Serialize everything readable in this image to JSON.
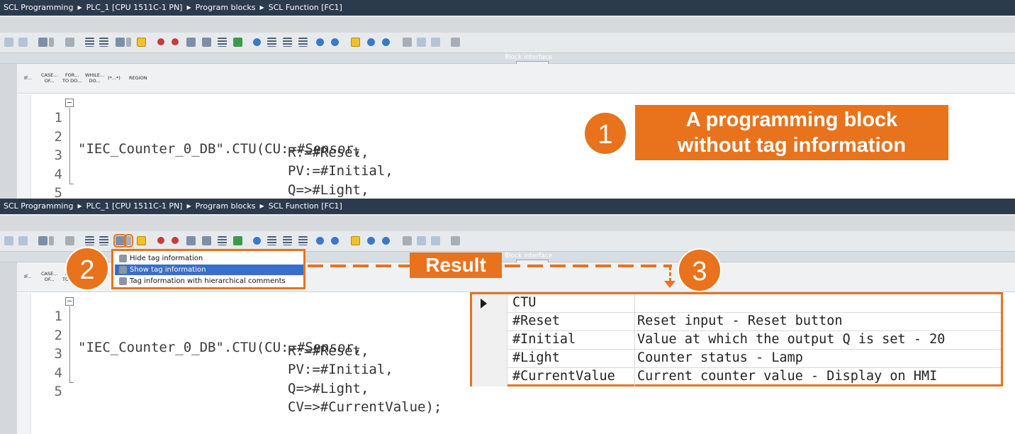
{
  "breadcrumb": [
    "SCL Programming",
    "PLC_1 [CPU 1511C-1 PN]",
    "Program blocks",
    "SCL Function [FC1]"
  ],
  "block_interface_label": "Block interface",
  "keywords": [
    {
      "l1": "IF...",
      "l2": ""
    },
    {
      "l1": "CASE...",
      "l2": "OF..."
    },
    {
      "l1": "FOR...",
      "l2": "TO DO..."
    },
    {
      "l1": "WHILE...",
      "l2": "DO..."
    },
    {
      "l1": "(*...*)",
      "l2": ""
    },
    {
      "l1": "REGION",
      "l2": ""
    }
  ],
  "code": {
    "line_numbers": [
      "1",
      "2",
      "3",
      "4",
      "5"
    ],
    "l1_str": "\"IEC_Counter_0_DB\"",
    "l1_dot": ".",
    "l1_fn": "CTU",
    "l1_rest": "(CU:=#Sensor,",
    "l2": "R:=#Reset,",
    "l3": "PV:=#Initial,",
    "l4": "Q=>#Light,",
    "l5": "CV=>#CurrentValue);"
  },
  "annotations": {
    "badge1": "1",
    "badge2": "2",
    "badge3": "3",
    "callout1_line1": "A programming block",
    "callout1_line2": "without tag information",
    "result_label": "Result",
    "accent": "#e8731c"
  },
  "menu": {
    "items": [
      "Hide tag information",
      "Show tag information",
      "Tag information with hierarchical comments"
    ],
    "selected_index": 1
  },
  "tag_info": {
    "rows": [
      {
        "name": "CTU",
        "comment": ""
      },
      {
        "name": "#Reset",
        "comment": "Reset input - Reset button"
      },
      {
        "name": "#Initial",
        "comment": "Value at which the output Q is set - 20"
      },
      {
        "name": "#Light",
        "comment": "Counter status - Lamp"
      },
      {
        "name": "#CurrentValue",
        "comment": "Current counter value - Display on HMI"
      }
    ]
  },
  "toolbar_icons": [
    "indent-icon",
    "outdent-icon",
    "insert-block-icon",
    "expand-icon",
    "align-icon",
    "list-icon",
    "tag-info-icon",
    "favorite-icon",
    "breakpoint-icon",
    "monitor-icon",
    "compare-icon",
    "bookmark-icon",
    "go-to-icon",
    "wrap-icon",
    "comment-icon",
    "uncomment-icon",
    "indent-right-icon",
    "format-icon",
    "level-icon",
    "goto-line-icon",
    "monitor-start-icon",
    "call-icon",
    "return-icon",
    "search-icon",
    "find-next-icon",
    "find-prev-icon",
    "lock-icon"
  ]
}
